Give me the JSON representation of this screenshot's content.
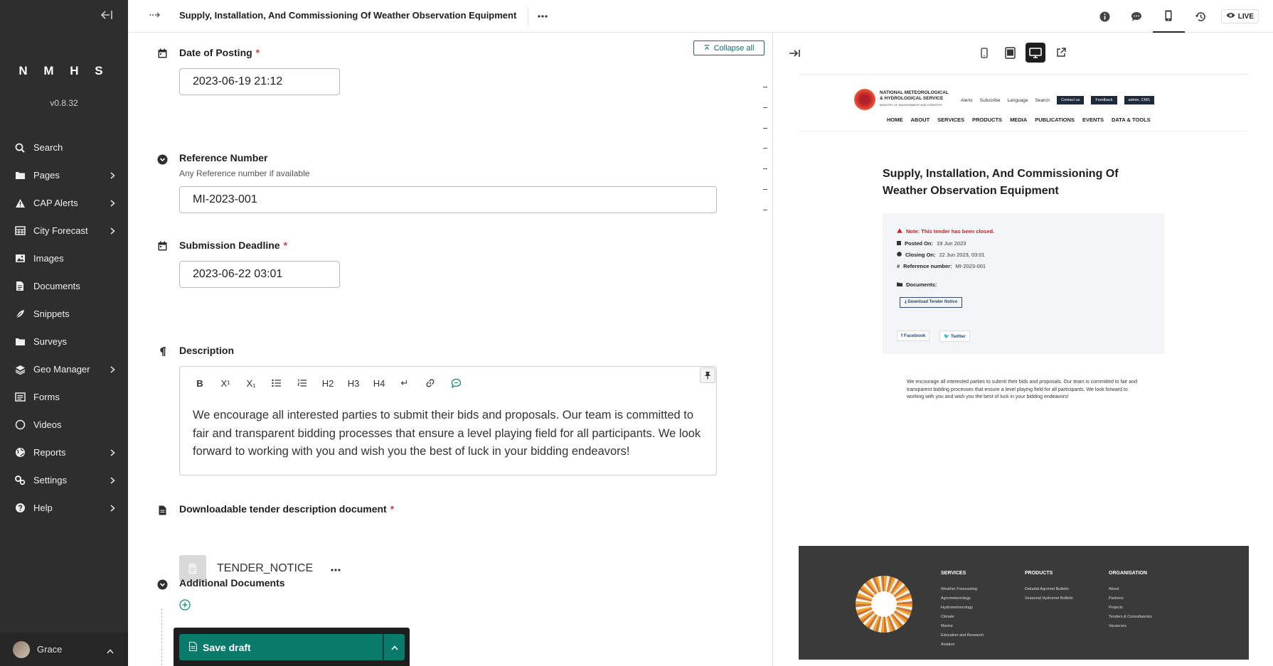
{
  "sidebar": {
    "brand": "N M H S",
    "version": "v0.8.32",
    "items": [
      {
        "label": "Search",
        "chevron": false,
        "icon": "search-icon"
      },
      {
        "label": "Pages",
        "chevron": true,
        "icon": "folder-icon"
      },
      {
        "label": "CAP Alerts",
        "chevron": true,
        "icon": "warning-icon"
      },
      {
        "label": "City Forecast",
        "chevron": true,
        "icon": "table-icon"
      },
      {
        "label": "Images",
        "chevron": false,
        "icon": "image-icon"
      },
      {
        "label": "Documents",
        "chevron": false,
        "icon": "document-icon"
      },
      {
        "label": "Snippets",
        "chevron": false,
        "icon": "snippet-icon"
      },
      {
        "label": "Surveys",
        "chevron": false,
        "icon": "folder-icon"
      },
      {
        "label": "Geo Manager",
        "chevron": true,
        "icon": "layers-icon"
      },
      {
        "label": "Forms",
        "chevron": false,
        "icon": "form-icon"
      },
      {
        "label": "Videos",
        "chevron": false,
        "icon": "circle-icon"
      },
      {
        "label": "Reports",
        "chevron": true,
        "icon": "globe-icon"
      },
      {
        "label": "Settings",
        "chevron": true,
        "icon": "cogs-icon"
      },
      {
        "label": "Help",
        "chevron": true,
        "icon": "help-icon"
      }
    ],
    "user": "Grace"
  },
  "header": {
    "title": "Supply, Installation, And Commissioning Of Weather Observation Equipment",
    "live": "LIVE"
  },
  "editor": {
    "collapse_all": "Collapse all",
    "date_of_posting": {
      "label": "Date of Posting",
      "required": "*",
      "value": "2023-06-19 21:12"
    },
    "reference_number": {
      "label": "Reference Number",
      "help": "Any Reference number if available",
      "value": "MI-2023-001"
    },
    "submission_deadline": {
      "label": "Submission Deadline",
      "required": "*",
      "value": "2023-06-22 03:01"
    },
    "description": {
      "label": "Description",
      "toolbar": [
        "B",
        "X¹",
        "X₁",
        "ul",
        "ol",
        "H2",
        "H3",
        "H4",
        "↵",
        "link",
        "comment"
      ],
      "text": "We encourage all interested parties to submit their bids and proposals. Our team is committed to fair and transparent bidding processes that ensure a level playing field for all participants. We look forward to working with you and wish you the best of luck in your bidding endeavors!"
    },
    "document": {
      "label": "Downloadable tender description document",
      "required": "*",
      "name": "TENDER_NOTICE"
    },
    "additional_documents": {
      "label": "Additional Documents"
    },
    "save_draft": "Save draft"
  },
  "preview": {
    "site": {
      "name_line1": "NATIONAL METEOROLOGICAL",
      "name_line2": "& HYDROLOGICAL SERVICE",
      "sub": "MINISTRY OF ENVIRONMENT AND FORESTRY",
      "util": [
        "Alerts",
        "Subscribe",
        "Language",
        "Search"
      ],
      "buttons": [
        "Contact us",
        "Feedback",
        "admin, CMS"
      ],
      "nav": [
        "HOME",
        "ABOUT",
        "SERVICES",
        "PRODUCTS",
        "MEDIA",
        "PUBLICATIONS",
        "EVENTS",
        "DATA & TOOLS"
      ]
    },
    "title": "Supply, Installation, And Commissioning Of Weather Observation Equipment",
    "note": "Note: This tender has been closed.",
    "posted_label": "Posted On:",
    "posted_value": "19 Jun 2023",
    "closing_label": "Closing On:",
    "closing_value": "22 Jun 2023, 03:01",
    "ref_label": "Reference number:",
    "ref_value": "MI-2023-001",
    "documents_label": "Documents:",
    "download": "Download Tender Notice",
    "facebook": "Facebook",
    "twitter": "Twitter",
    "body": "We encourage all interested parties to submit their bids and proposals. Our team is committed to fair and transparent bidding processes that ensure a level playing field for all participants. We look forward to working with you and wish you the best of luck in your bidding endeavors!",
    "footer": {
      "services": {
        "title": "SERVICES",
        "items": [
          "Weather Forecasting",
          "Agrometeorology",
          "Hydrometeorology",
          "Climate",
          "Marine",
          "Education and Research",
          "Aviation"
        ]
      },
      "products": {
        "title": "PRODUCTS",
        "items": [
          "Dekadal Agromet Bulletin",
          "Seasonal Hydromet Bulletin"
        ]
      },
      "organisation": {
        "title": "ORGANISATION",
        "items": [
          "About",
          "Partners",
          "Projects",
          "Tenders & Consultancies",
          "Vacancies"
        ]
      }
    }
  }
}
